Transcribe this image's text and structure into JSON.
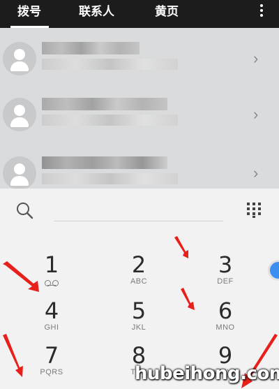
{
  "tabs": [
    {
      "label": "拨号",
      "active": true
    },
    {
      "label": "联系人",
      "active": false
    },
    {
      "label": "黄页",
      "active": false
    }
  ],
  "call_log": {
    "rows": [
      {
        "name": "",
        "detail": ""
      },
      {
        "name": "",
        "detail": ""
      },
      {
        "name": "",
        "detail": ""
      }
    ]
  },
  "keypad": {
    "keys": [
      {
        "digit": "1",
        "letters": "",
        "icon": "voicemail-icon"
      },
      {
        "digit": "2",
        "letters": "ABC"
      },
      {
        "digit": "3",
        "letters": "DEF"
      },
      {
        "digit": "4",
        "letters": "GHI"
      },
      {
        "digit": "5",
        "letters": "JKL"
      },
      {
        "digit": "6",
        "letters": "MNO"
      },
      {
        "digit": "7",
        "letters": "PQRS"
      },
      {
        "digit": "8",
        "letters": "TUV"
      },
      {
        "digit": "9",
        "letters": "WXYZ"
      }
    ]
  },
  "watermark": "hubeihong.com",
  "colors": {
    "topbar": "#1c1c1c",
    "list_background": "#dadbdc",
    "dialer_background": "#f2f2f3",
    "annotation_arrow": "#e8201c",
    "side_button": "#3b8ff0"
  }
}
